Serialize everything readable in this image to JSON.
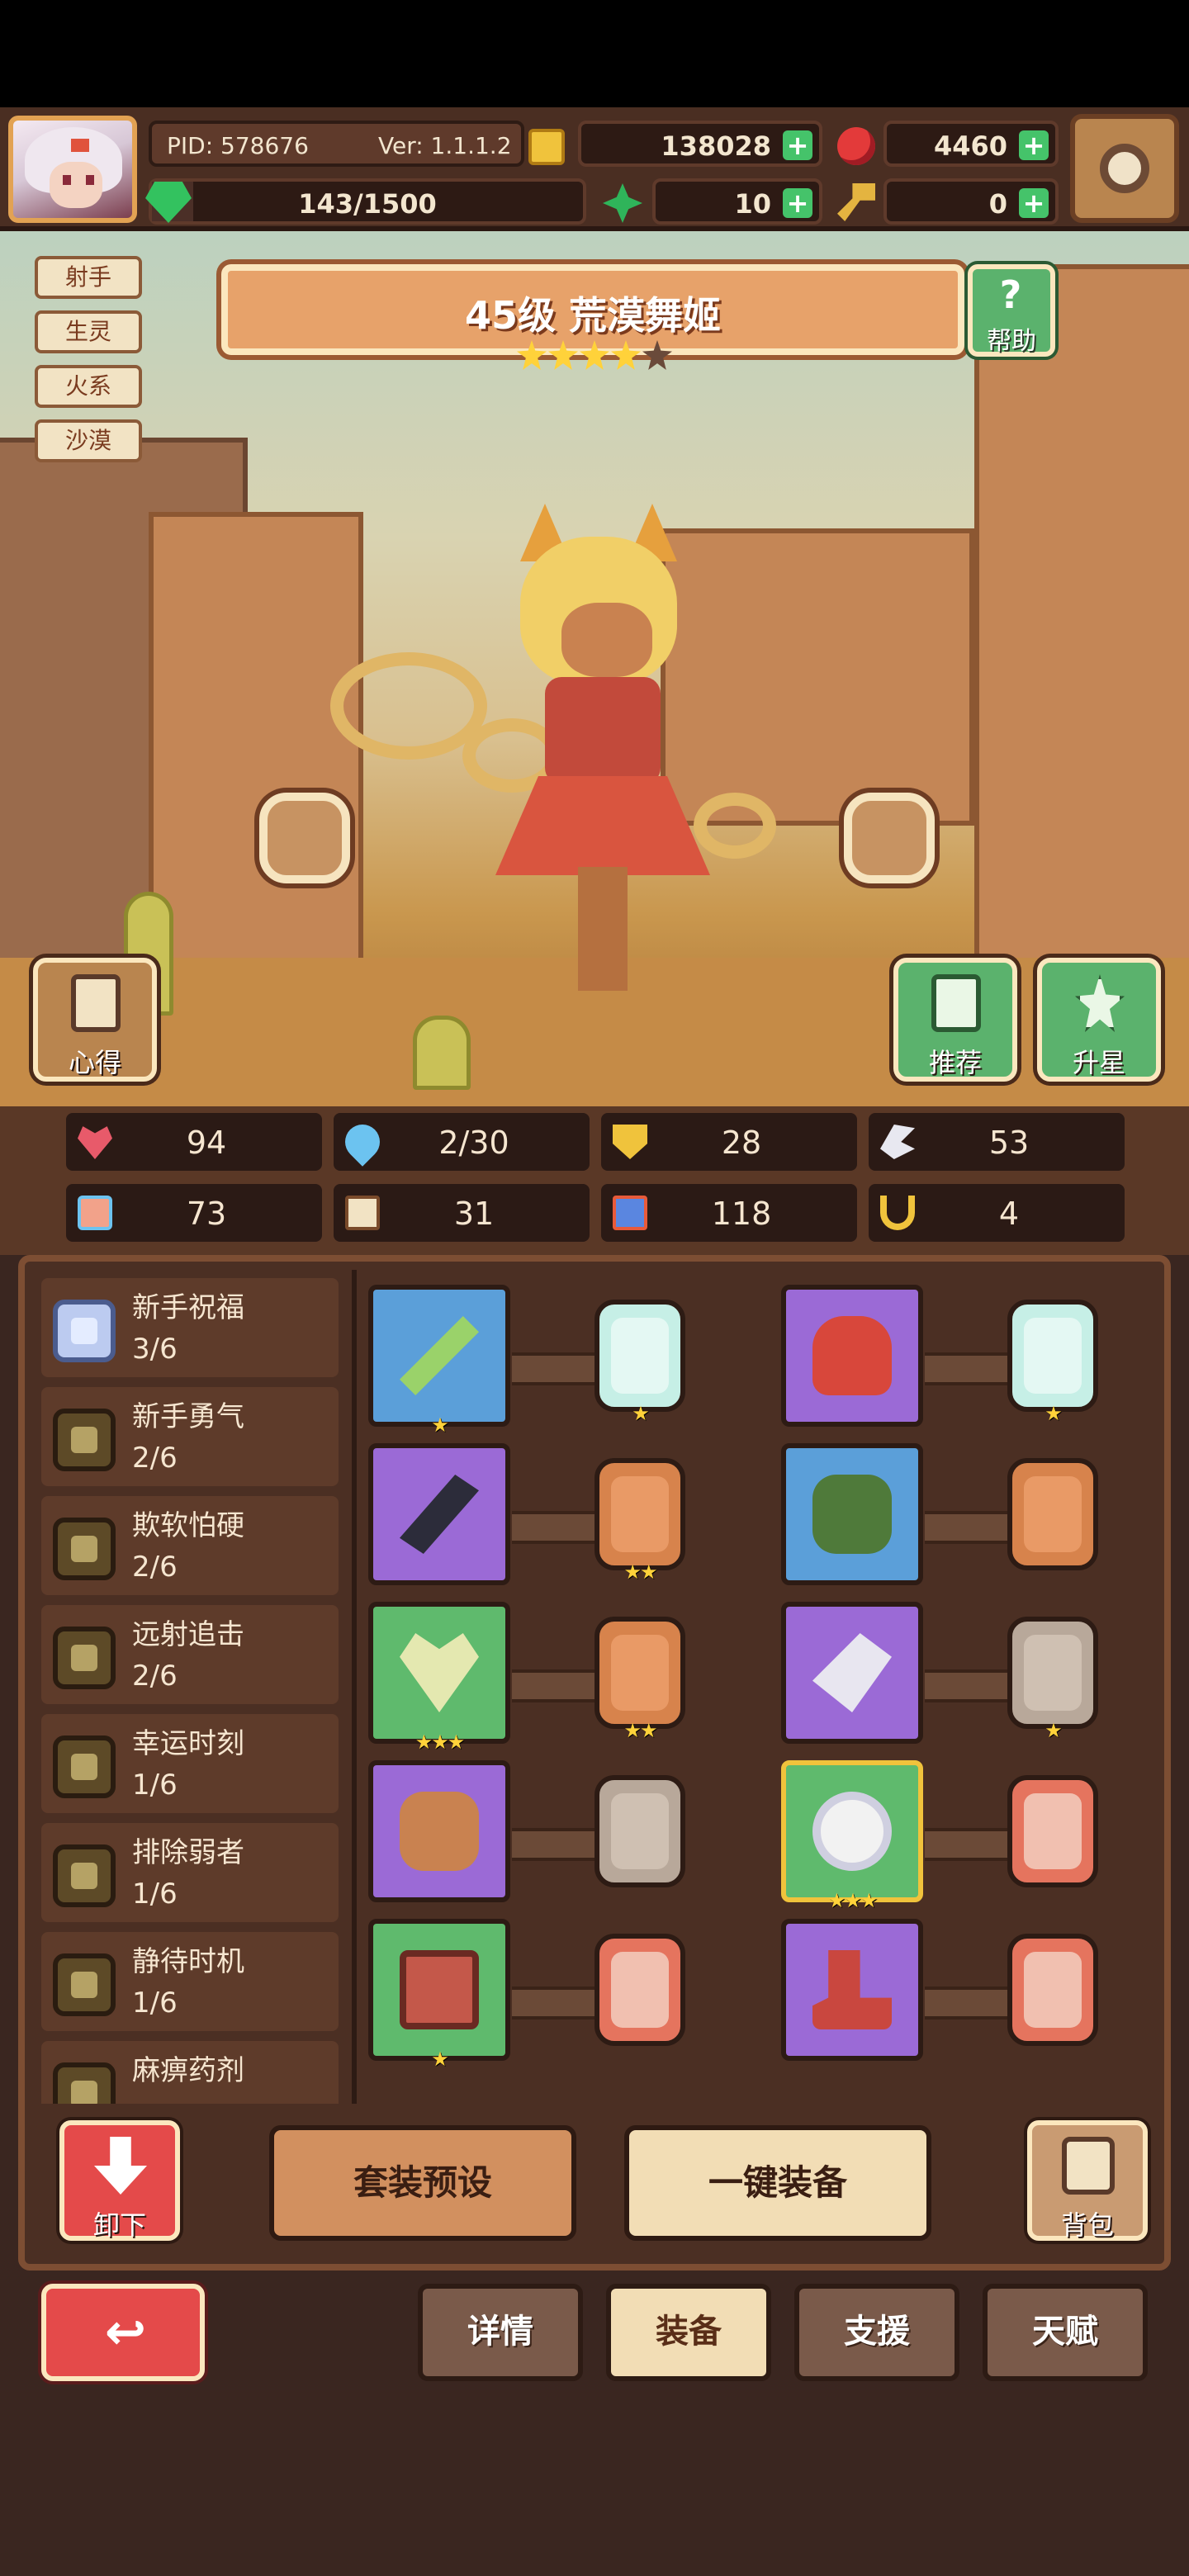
{
  "hud": {
    "pid": "PID: 578676",
    "version": "Ver: 1.1.1.2",
    "energy": "143/1500",
    "energy_fill": 0.095,
    "gold": "138028",
    "ruby": "4460",
    "clover": "10",
    "keys": "0",
    "plus": "+"
  },
  "tags": [
    "射手",
    "生灵",
    "火系",
    "沙漠"
  ],
  "hero": {
    "title": "45级 荒漠舞姬",
    "stars_on": 4,
    "stars_total": 5,
    "help_label": "帮助",
    "help_q": "?",
    "insight_label": "心得",
    "recommend_label": "推荐",
    "star_up_label": "升星"
  },
  "stats": [
    {
      "icon": "heart-icon",
      "value": "94"
    },
    {
      "icon": "water-drop-icon",
      "value": "2/30"
    },
    {
      "icon": "shield-icon",
      "value": "28"
    },
    {
      "icon": "wing-icon",
      "value": "53"
    },
    {
      "icon": "fist-icon",
      "value": "73"
    },
    {
      "icon": "book-icon",
      "value": "31"
    },
    {
      "icon": "potion-icon",
      "value": "118"
    },
    {
      "icon": "horseshoe-icon",
      "value": "4"
    }
  ],
  "sets": [
    {
      "name": "新手祝福",
      "progress": "3/6"
    },
    {
      "name": "新手勇气",
      "progress": "2/6"
    },
    {
      "name": "欺软怕硬",
      "progress": "2/6"
    },
    {
      "name": "远射追击",
      "progress": "2/6"
    },
    {
      "name": "幸运时刻",
      "progress": "1/6"
    },
    {
      "name": "排除弱者",
      "progress": "1/6"
    },
    {
      "name": "静待时机",
      "progress": "1/6"
    },
    {
      "name": "麻痹药剂",
      "progress": ""
    }
  ],
  "equipment": {
    "left": [
      {
        "item": "bow",
        "rarity": "blue",
        "stars": "★",
        "gem_stars": "★"
      },
      {
        "item": "dagger",
        "rarity": "purple",
        "stars": "",
        "gem_stars": "★★"
      },
      {
        "item": "necklace",
        "rarity": "green",
        "stars": "★★★",
        "gem_stars": "★★"
      },
      {
        "item": "lion-shield",
        "rarity": "purple",
        "stars": "",
        "gem_stars": ""
      },
      {
        "item": "chest",
        "rarity": "green",
        "stars": "★",
        "gem_stars": ""
      }
    ],
    "right": [
      {
        "item": "red-helmet",
        "rarity": "purple",
        "stars": "",
        "gem_stars": "★"
      },
      {
        "item": "green-armor",
        "rarity": "blue",
        "stars": "",
        "gem_stars": ""
      },
      {
        "item": "gauntlet",
        "rarity": "purple",
        "stars": "",
        "gem_stars": "★"
      },
      {
        "item": "ring",
        "rarity": "green",
        "stars": "★★★",
        "gem_stars": ""
      },
      {
        "item": "boots",
        "rarity": "purple",
        "stars": "",
        "gem_stars": ""
      }
    ]
  },
  "actions": {
    "unequip": "卸下",
    "preset": "套装预设",
    "auto_equip": "一键装备",
    "bag": "背包"
  },
  "tabs": [
    {
      "label": "详情",
      "active": false
    },
    {
      "label": "装备",
      "active": true
    },
    {
      "label": "支援",
      "active": false
    },
    {
      "label": "天赋",
      "active": false
    }
  ],
  "colors": {
    "accent": "#e7a26a",
    "cream": "#fbe7be",
    "panel": "#4b2f23",
    "green_btn": "#5bb26d",
    "red_btn": "#e44a4a"
  }
}
